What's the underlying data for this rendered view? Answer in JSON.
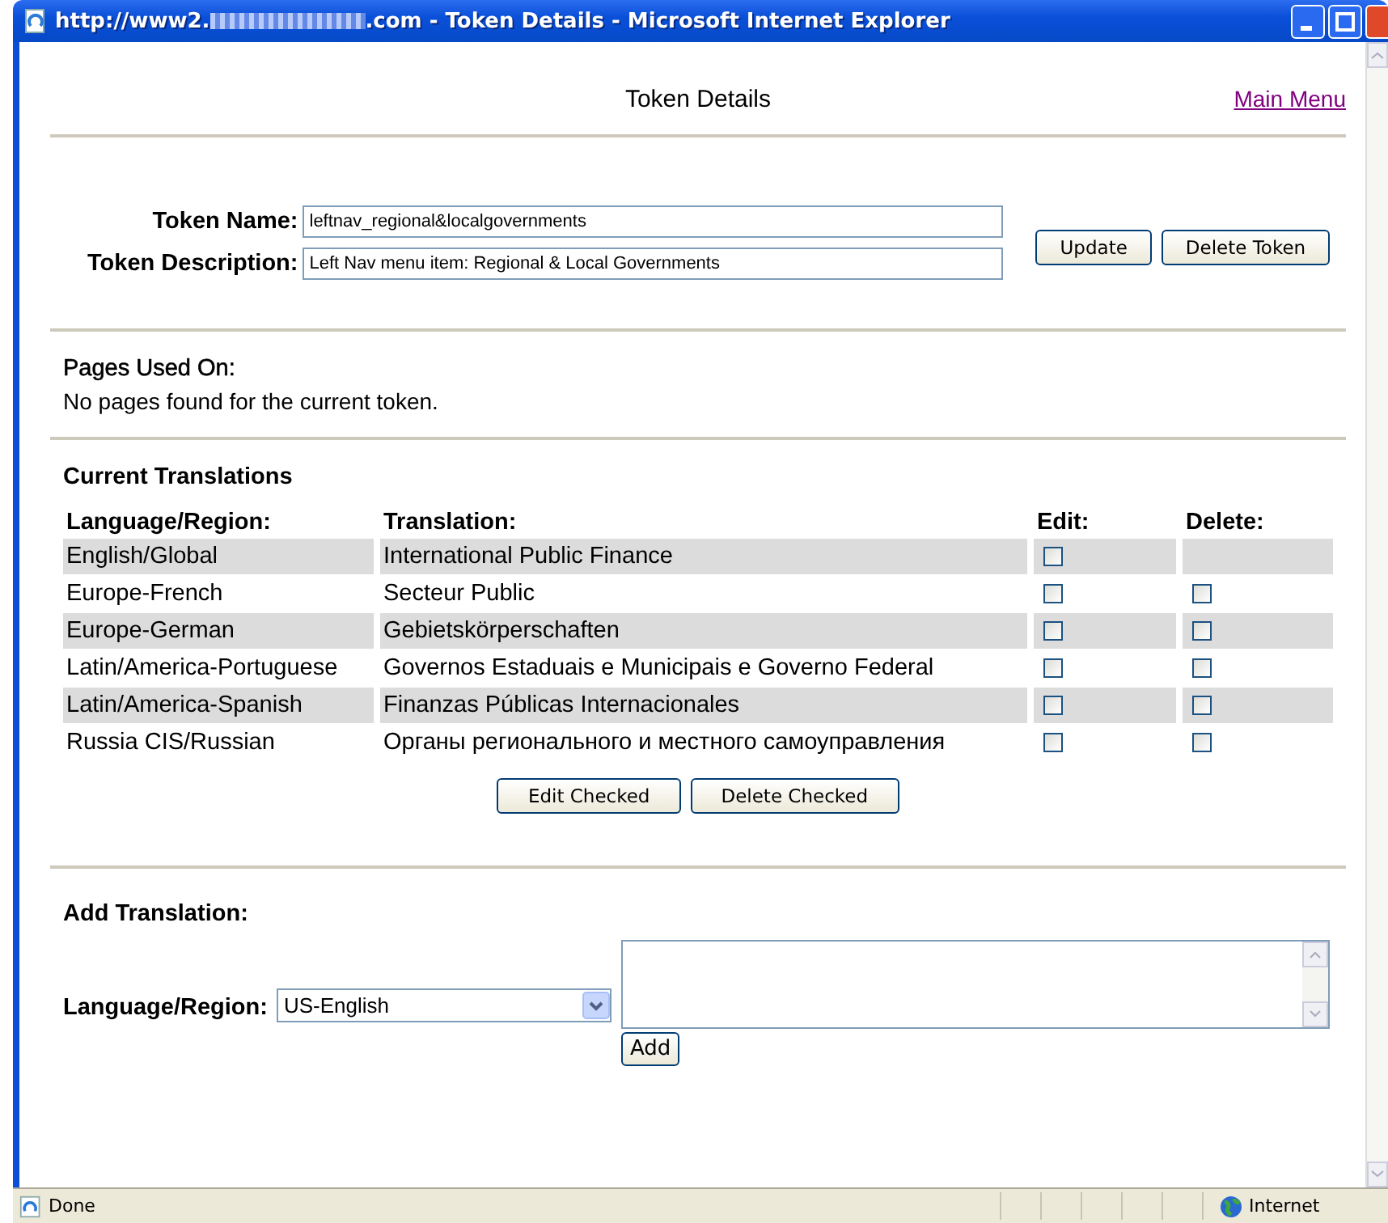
{
  "window": {
    "title_prefix": "http://www2.",
    "title_suffix": ".com - Token Details - Microsoft Internet Explorer"
  },
  "page": {
    "heading": "Token Details",
    "main_menu_link": "Main Menu"
  },
  "token": {
    "name_label": "Token Name:",
    "name_value": "leftnav_regional&localgovernments",
    "description_label": "Token Description:",
    "description_value": "Left Nav menu item: Regional & Local Governments",
    "buttons": [
      "Update",
      "Delete Token"
    ]
  },
  "pages_used": {
    "heading": "Pages Used On:",
    "message": "No pages found for the current token."
  },
  "translations": {
    "heading": "Current Translations",
    "columns": [
      "Language/Region:",
      "Translation:",
      "Edit:",
      "Delete:"
    ],
    "rows": [
      {
        "language": "English/Global",
        "translation": "International Public Finance",
        "edit_checked": false
      },
      {
        "language": "Europe-French",
        "translation": "Secteur Public",
        "edit_checked": false,
        "delete_checked": false
      },
      {
        "language": "Europe-German",
        "translation": "Gebietskörperschaften",
        "edit_checked": false,
        "delete_checked": false
      },
      {
        "language": "Latin/America-Portuguese",
        "translation": "Governos Estaduais e Municipais e Governo Federal",
        "edit_checked": false,
        "delete_checked": false
      },
      {
        "language": "Latin/America-Spanish",
        "translation": "Finanzas Públicas Internacionales",
        "edit_checked": false,
        "delete_checked": false
      },
      {
        "language": "Russia CIS/Russian",
        "translation": "Органы регионального и местного самоуправления",
        "edit_checked": false,
        "delete_checked": false
      }
    ],
    "buttons": [
      "Edit Checked",
      "Delete Checked"
    ]
  },
  "add_translation": {
    "heading": "Add Translation:",
    "language_label": "Language/Region:",
    "language_value": "US-English",
    "button": "Add"
  },
  "status_bar": {
    "text": "Done",
    "zone": "Internet"
  }
}
